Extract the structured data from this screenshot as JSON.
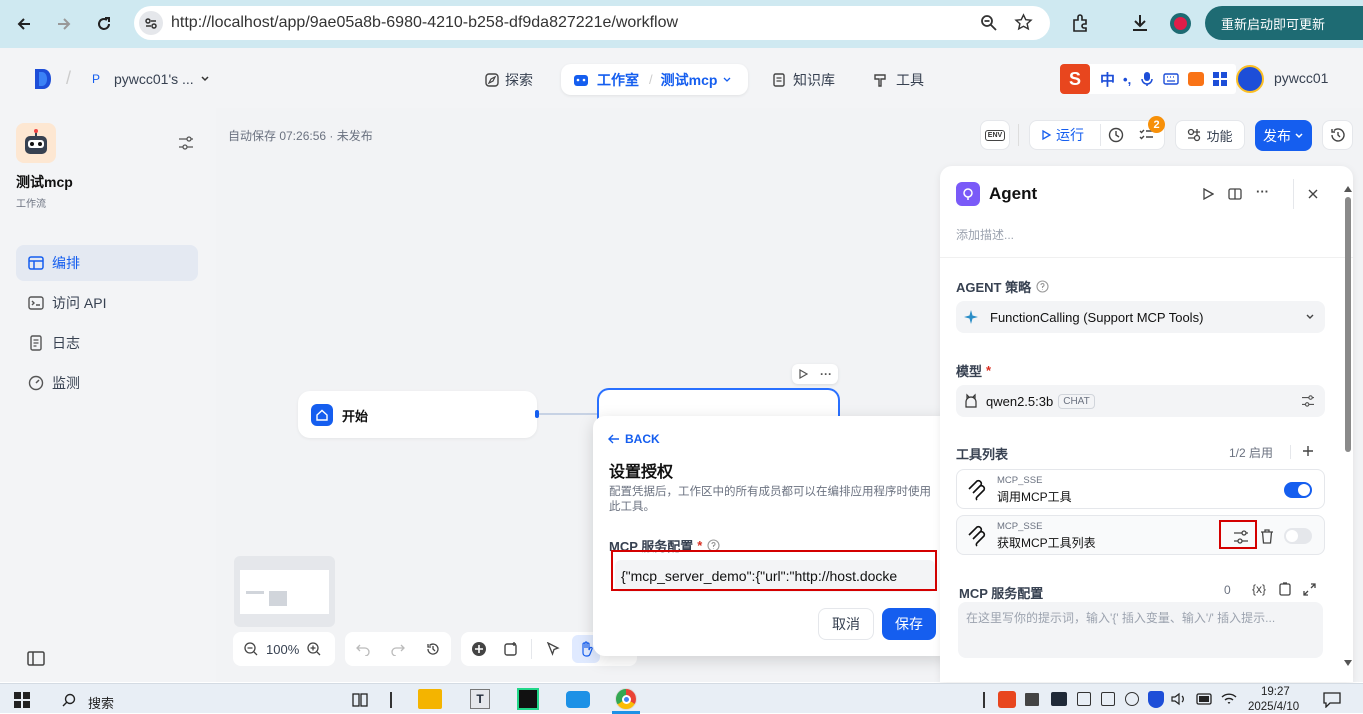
{
  "browser": {
    "url": "http://localhost/app/9ae05a8b-6980-4210-b258-df9da827221e/workflow",
    "update_label": "重新启动即可更新"
  },
  "header": {
    "workspace_initial": "P",
    "workspace_name": "pywcc01's ...",
    "nav_explore": "探索",
    "nav_studio": "工作室",
    "nav_app": "测试mcp",
    "nav_knowledge": "知识库",
    "nav_tools": "工具",
    "ime_label": "中",
    "username": "pywcc01"
  },
  "sidebar": {
    "app_name": "测试mcp",
    "app_type": "工作流",
    "items": [
      {
        "label": "编排",
        "icon": "layout-icon"
      },
      {
        "label": "访问 API",
        "icon": "terminal-icon"
      },
      {
        "label": "日志",
        "icon": "document-icon"
      },
      {
        "label": "监测",
        "icon": "monitor-icon"
      }
    ]
  },
  "canvas": {
    "autosave": "自动保存 07:26:56 · 未发布",
    "run_label": "运行",
    "features_label": "功能",
    "publish_label": "发布",
    "checklist_badge": "2",
    "env_label": "ENV",
    "start_node_label": "开始",
    "zoom_level": "100%"
  },
  "popup": {
    "back_label": "BACK",
    "title": "设置授权",
    "description": "配置凭据后，工作区中的所有成员都可以在编排应用程序时使用此工具。",
    "field_label": "MCP 服务配置",
    "required_mark": "*",
    "field_value": "{\"mcp_server_demo\":{\"url\":\"http://host.docke",
    "cancel_label": "取消",
    "save_label": "保存"
  },
  "panel": {
    "title": "Agent",
    "description_placeholder": "添加描述...",
    "strategy_label": "AGENT 策略",
    "strategy_value": "FunctionCalling (Support MCP Tools)",
    "model_label": "模型",
    "required_mark": "*",
    "model_value": "qwen2.5:3b",
    "model_tag": "CHAT",
    "tools_label": "工具列表",
    "tools_count": "1/2 启用",
    "tools": [
      {
        "provider": "MCP_SSE",
        "name": "调用MCP工具",
        "enabled": true
      },
      {
        "provider": "MCP_SSE",
        "name": "获取MCP工具列表",
        "enabled": false
      }
    ],
    "mcp_config_label": "MCP 服务配置",
    "mcp_char_count": "0",
    "mcp_var_label": "{x}",
    "prompt_placeholder": "在这里写你的提示词，输入'{' 插入变量、输入'/' 插入提示..."
  },
  "taskbar": {
    "search_label": "搜索",
    "time": "19:27",
    "date": "2025/4/10"
  },
  "colors": {
    "primary": "#155eef",
    "highlight_box": "#d40000",
    "toggle_on": "#155eef",
    "toggle_off": "#e5e7eb"
  }
}
